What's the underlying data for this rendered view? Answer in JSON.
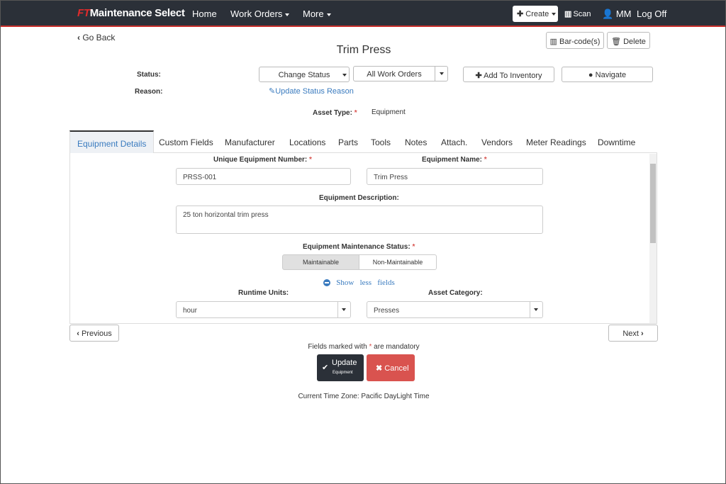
{
  "navbar": {
    "brand_prefix": "FT",
    "brand_name": "Maintenance Select",
    "home": "Home",
    "work_orders": "Work Orders",
    "more": "More",
    "create": "Create",
    "scan": "Scan",
    "user": "MM",
    "logoff": "Log Off"
  },
  "header": {
    "go_back": "Go Back",
    "title": "Trim Press",
    "barcodes": "Bar-code(s)",
    "delete": "Delete"
  },
  "status": {
    "status_label": "Status:",
    "reason_label": "Reason:",
    "change_status": "Change Status",
    "all_work_orders": "All Work Orders",
    "add_to_inventory": "Add To Inventory",
    "navigate": "Navigate",
    "update_reason": "Update Status Reason",
    "asset_type_label": "Asset Type:",
    "asset_type_value": "Equipment"
  },
  "tabs": [
    "Equipment Details",
    "Custom Fields",
    "Manufacturer",
    "Locations",
    "Parts",
    "Tools",
    "Notes",
    "Attach.",
    "Vendors",
    "Meter Readings",
    "Downtime"
  ],
  "form": {
    "unique_number_label": "Unique Equipment Number:",
    "unique_number_value": "PRSS-001",
    "name_label": "Equipment Name:",
    "name_value": "Trim Press",
    "description_label": "Equipment Description:",
    "description_value": "25 ton horizontal trim press",
    "maint_status_label": "Equipment Maintenance Status:",
    "maintainable": "Maintainable",
    "non_maintainable": "Non-Maintainable",
    "show": "Show",
    "less": "less",
    "fields": "fields",
    "runtime_label": "Runtime Units:",
    "runtime_value": "hour",
    "category_label": "Asset Category:",
    "category_value": "Presses"
  },
  "footer": {
    "previous": "Previous",
    "next": "Next",
    "mandatory_pre": "Fields marked with",
    "mandatory_star": "*",
    "mandatory_post": "are mandatory",
    "update": "Update",
    "update_sub": "Equipment",
    "cancel": "Cancel",
    "timezone": "Current Time Zone: Pacific DayLight Time"
  },
  "colors": {
    "navbar": "#2b3038",
    "accent_red": "#d9534f",
    "link_blue": "#3a7bbf"
  }
}
